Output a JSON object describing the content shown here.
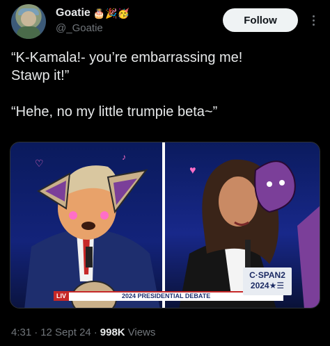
{
  "author": {
    "display_name": "Goatie",
    "name_emojis": "🎂🎉🥳",
    "handle": "@_Goatie"
  },
  "actions": {
    "follow_label": "Follow"
  },
  "tweet": {
    "line1": "“K-Kamala!- you’re embarrassing me!",
    "line2": "Stawp it!”",
    "line3": "“Hehe, no my little trumpie beta~”"
  },
  "media": {
    "live_label": "LIV",
    "debate_banner": "2024 PRESIDENTIAL DEBATE",
    "network_line1": "C·SPAN2",
    "network_line2": "2024★☰"
  },
  "meta": {
    "time": "4:31",
    "date": "12 Sept 24",
    "views_count": "998K",
    "views_label": "Views",
    "separator": "·"
  }
}
